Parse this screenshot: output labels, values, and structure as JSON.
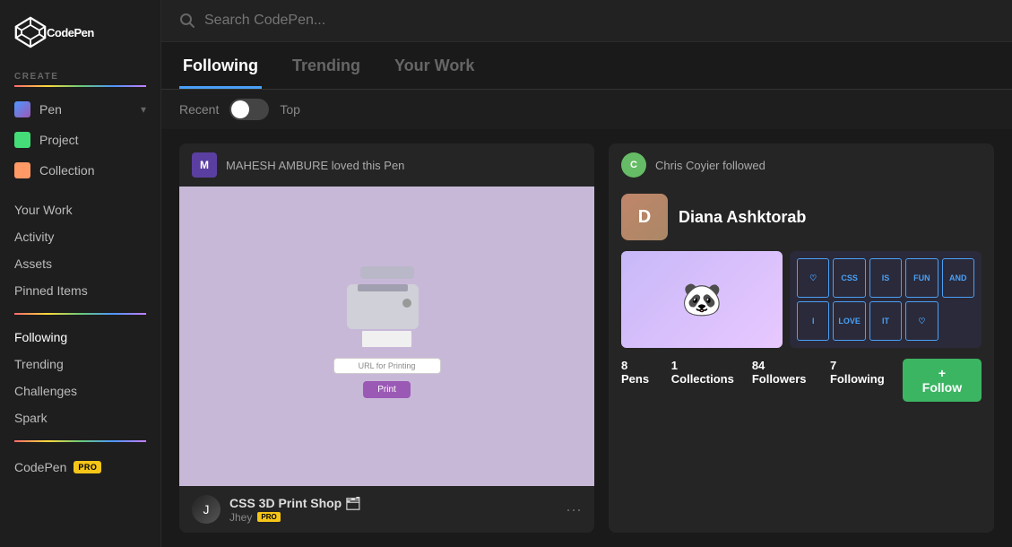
{
  "app": {
    "name": "CodePen"
  },
  "sidebar": {
    "create_label": "CREATE",
    "items": [
      {
        "id": "pen",
        "label": "Pen",
        "has_chevron": true
      },
      {
        "id": "project",
        "label": "Project"
      },
      {
        "id": "collection",
        "label": "Collection"
      }
    ],
    "nav_items": [
      {
        "id": "your-work",
        "label": "Your Work"
      },
      {
        "id": "activity",
        "label": "Activity"
      },
      {
        "id": "assets",
        "label": "Assets"
      },
      {
        "id": "pinned-items",
        "label": "Pinned Items"
      }
    ],
    "explore_items": [
      {
        "id": "following",
        "label": "Following",
        "active": true
      },
      {
        "id": "trending",
        "label": "Trending"
      },
      {
        "id": "challenges",
        "label": "Challenges"
      },
      {
        "id": "spark",
        "label": "Spark"
      }
    ],
    "codepen_pro": {
      "label": "CodePen",
      "badge": "PRO"
    }
  },
  "search": {
    "placeholder": "Search CodePen..."
  },
  "tabs": [
    {
      "id": "following",
      "label": "Following",
      "active": true
    },
    {
      "id": "trending",
      "label": "Trending"
    },
    {
      "id": "your-work",
      "label": "Your Work"
    }
  ],
  "filter": {
    "recent_label": "Recent",
    "top_label": "Top"
  },
  "left_feed": {
    "action_text": "MAHESH AMBURE loved this Pen",
    "user_initials": "M",
    "pen_title": "CSS 3D Print Shop 🗂",
    "pen_author": "Jhey",
    "author_badge": "PRO",
    "url_input": "URL for Printing",
    "print_btn": "Print"
  },
  "right_feed": {
    "action_text": "Chris Coyier followed",
    "user_name": "Diana Ashktorab",
    "stats": {
      "pens": "8",
      "pens_label": "Pens",
      "followers": "84",
      "followers_label": "Followers",
      "following": "7",
      "following_label": "Following",
      "collections": "1",
      "collections_label": "Collections"
    },
    "follow_btn": "+ Follow",
    "css_tags": [
      "♡",
      "CSS",
      "IS",
      "FUN",
      "AND",
      "I",
      "LOVE",
      "IT",
      "♡"
    ]
  }
}
